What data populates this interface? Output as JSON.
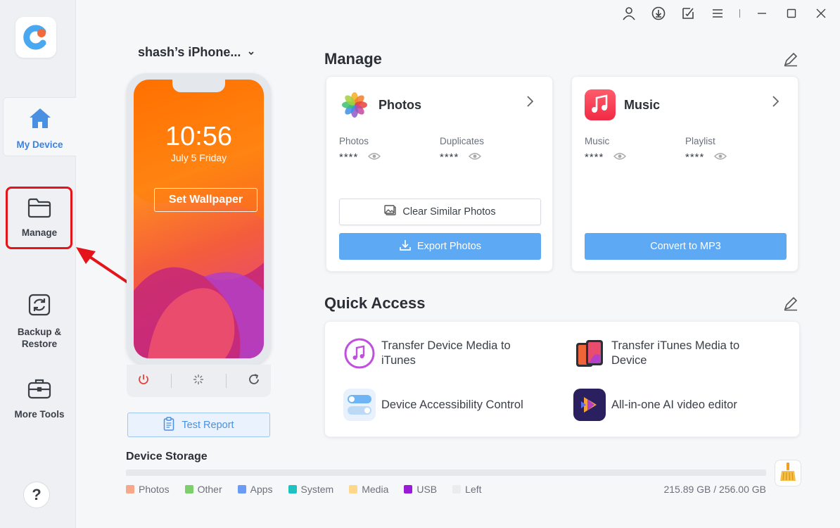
{
  "sidebar": {
    "items": [
      {
        "label": "My Device"
      },
      {
        "label": "Manage"
      },
      {
        "label": "Backup &\nRestore"
      },
      {
        "label": "More Tools"
      }
    ],
    "help": "?"
  },
  "device": {
    "name": "shash’s iPhone...",
    "time": "10:56",
    "date": "July 5 Friday",
    "wallpaper_button": "Set Wallpaper",
    "test_report": "Test Report"
  },
  "manage": {
    "title": "Manage",
    "photos": {
      "title": "Photos",
      "stat1_label": "Photos",
      "stat1_value": "****",
      "stat2_label": "Duplicates",
      "stat2_value": "****",
      "clear_button": "Clear Similar Photos",
      "export_button": "Export Photos"
    },
    "music": {
      "title": "Music",
      "stat1_label": "Music",
      "stat1_value": "****",
      "stat2_label": "Playlist",
      "stat2_value": "****",
      "convert_button": "Convert to MP3"
    }
  },
  "quick_access": {
    "title": "Quick Access",
    "items": [
      {
        "label": "Transfer Device Media to\niTunes"
      },
      {
        "label": "Transfer iTunes Media to\nDevice"
      },
      {
        "label": "Device Accessibility Control"
      },
      {
        "label": "All-in-one AI video editor"
      }
    ]
  },
  "storage": {
    "title": "Device Storage",
    "legend": [
      {
        "label": "Photos",
        "color": "#f6a98a"
      },
      {
        "label": "Other",
        "color": "#7ccf6b"
      },
      {
        "label": "Apps",
        "color": "#6a9cf5"
      },
      {
        "label": "System",
        "color": "#1fc1c1"
      },
      {
        "label": "Media",
        "color": "#fdd88a"
      },
      {
        "label": "USB",
        "color": "#9a1bd6"
      },
      {
        "label": "Left",
        "color": "#ececee"
      }
    ],
    "size": "215.89 GB / 256.00 GB"
  },
  "colors": {
    "accent": "#3b82e6",
    "primary_button": "#5ea9f3",
    "highlight": "#e5141a"
  }
}
